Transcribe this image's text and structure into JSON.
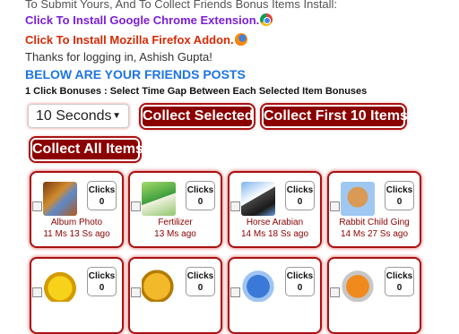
{
  "header": {
    "intro": "To Submit Yours, And To Collect Friends Bonus Items Install:",
    "chrome_link": "Click To Install Google Chrome Extension.",
    "firefox_link": "Click To Install Mozilla Firefox Addon.",
    "thanks": "Thanks for logging in, Ashish Gupta!",
    "friends_heading": "BELOW ARE YOUR FRIENDS POSTS",
    "bonus_hint": "1 Click Bonuses : Select Time Gap Between Each Selected Item Bonuses"
  },
  "controls": {
    "time_gap_selected": "10 Seconds",
    "collect_selected_label": "Collect Selected",
    "collect_first_label": "Collect First 10 Items",
    "collect_all_label": "Collect All Items"
  },
  "items": [
    {
      "name": "Album Photo",
      "time": "11 Ms 13 Ss ago",
      "clicks_label": "Clicks",
      "clicks": "0",
      "icon": "album-photo-icon"
    },
    {
      "name": "Fertilizer",
      "time": "13 Ms ago",
      "clicks_label": "Clicks",
      "clicks": "0",
      "icon": "fertilizer-icon"
    },
    {
      "name": "Horse Arabian",
      "time": "14 Ms 18 Ss ago",
      "clicks_label": "Clicks",
      "clicks": "0",
      "icon": "horse-icon"
    },
    {
      "name": "Rabbit Child Ging",
      "time": "14 Ms 27 Ss ago",
      "clicks_label": "Clicks",
      "clicks": "0",
      "icon": "rabbit-icon"
    },
    {
      "name": "",
      "time": "",
      "clicks_label": "Clicks",
      "clicks": "0",
      "icon": "gold-pile-icon"
    },
    {
      "name": "",
      "time": "",
      "clicks_label": "Clicks",
      "clicks": "0",
      "icon": "coins-icon"
    },
    {
      "name": "",
      "time": "",
      "clicks_label": "Clicks",
      "clicks": "0",
      "icon": "blue-item-icon"
    },
    {
      "name": "",
      "time": "",
      "clicks_label": "Clicks",
      "clicks": "0",
      "icon": "orange-item-icon"
    }
  ]
}
